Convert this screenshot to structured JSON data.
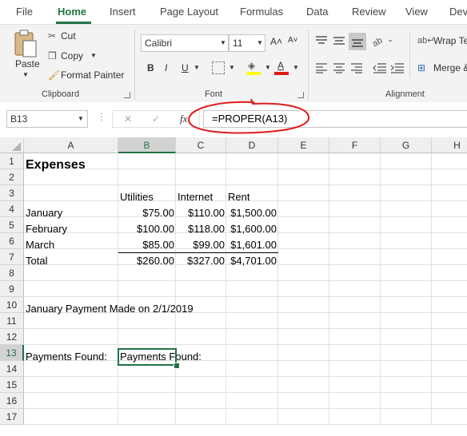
{
  "tabs": [
    "File",
    "Home",
    "Insert",
    "Page Layout",
    "Formulas",
    "Data",
    "Review",
    "View",
    "Dev"
  ],
  "ribbon": {
    "clipboard": {
      "paste": "Paste",
      "cut": "Cut",
      "copy": "Copy",
      "format_painter": "Format Painter",
      "label": "Clipboard"
    },
    "font": {
      "name": "Calibri",
      "size": "11",
      "grow": "A˄",
      "shrink": "A˅",
      "bold": "B",
      "italic": "I",
      "underline": "U",
      "label": "Font"
    },
    "alignment": {
      "wrap_text": "Wrap Te",
      "merge": "Merge &",
      "label": "Alignment"
    }
  },
  "formula_bar": {
    "name_box": "B13",
    "cancel": "✕",
    "enter": "✓",
    "fx": "fx",
    "formula": "=PROPER(A13)"
  },
  "columns": [
    "A",
    "B",
    "C",
    "D",
    "E",
    "F",
    "G",
    "H"
  ],
  "rows": [
    "1",
    "2",
    "3",
    "4",
    "5",
    "6",
    "7",
    "8",
    "9",
    "10",
    "11",
    "12",
    "13",
    "14",
    "15",
    "16",
    "17"
  ],
  "cells": {
    "A1": "Expenses",
    "B3": "Utilities",
    "C3": "Internet",
    "D3": "Rent",
    "A4": "January",
    "B4": "$75.00",
    "C4": "$110.00",
    "D4": "$1,500.00",
    "A5": "February",
    "B5": "$100.00",
    "C5": "$118.00",
    "D5": "$1,600.00",
    "A6": "March",
    "B6": "$85.00",
    "C6": "$99.00",
    "D6": "$1,601.00",
    "A7": "Total",
    "B7": "$260.00",
    "C7": "$327.00",
    "D7": "$4,701.00",
    "A10": "January Payment Made on 2/1/2019",
    "A13": "Payments Found:",
    "B13": "Payments Found:"
  },
  "selected_cell": "B13",
  "colors": {
    "accent": "#217346",
    "annotation": "#e11b1b"
  }
}
